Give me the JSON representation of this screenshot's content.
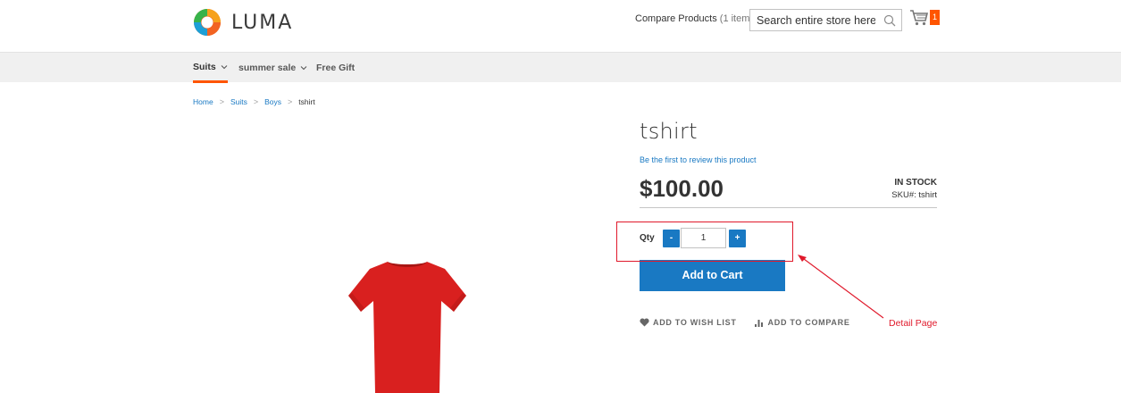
{
  "header": {
    "logo_text": "LUMA",
    "compare": {
      "label": "Compare Products",
      "count": "(1 item)"
    },
    "search": {
      "placeholder": "Search entire store here..."
    },
    "cart": {
      "count": "1"
    }
  },
  "nav": {
    "items": [
      {
        "label": "Suits",
        "has_dropdown": true,
        "active": true
      },
      {
        "label": "summer sale",
        "has_dropdown": true,
        "active": false
      },
      {
        "label": "Free Gift",
        "has_dropdown": false,
        "active": false
      }
    ]
  },
  "breadcrumb": {
    "links": [
      "Home",
      "Suits",
      "Boys"
    ],
    "current": "tshirt",
    "separator": ">"
  },
  "product": {
    "title": "tshirt",
    "review_link": "Be the first to review this product",
    "price": "$100.00",
    "stock": "IN STOCK",
    "sku_label": "SKU#:",
    "sku_value": "tshirt",
    "qty_label": "Qty",
    "qty_value": "1",
    "qty_minus": "-",
    "qty_plus": "+",
    "add_to_cart": "Add to Cart",
    "wishlist": "ADD TO WISH LIST",
    "compare": "ADD TO COMPARE",
    "image_color": "#d9201f"
  },
  "annotation": {
    "label": "Detail Page",
    "color": "#e0192b"
  },
  "colors": {
    "accent": "#1979c3",
    "brand_orange": "#ff5501",
    "nav_bg": "#f0f0f0"
  }
}
